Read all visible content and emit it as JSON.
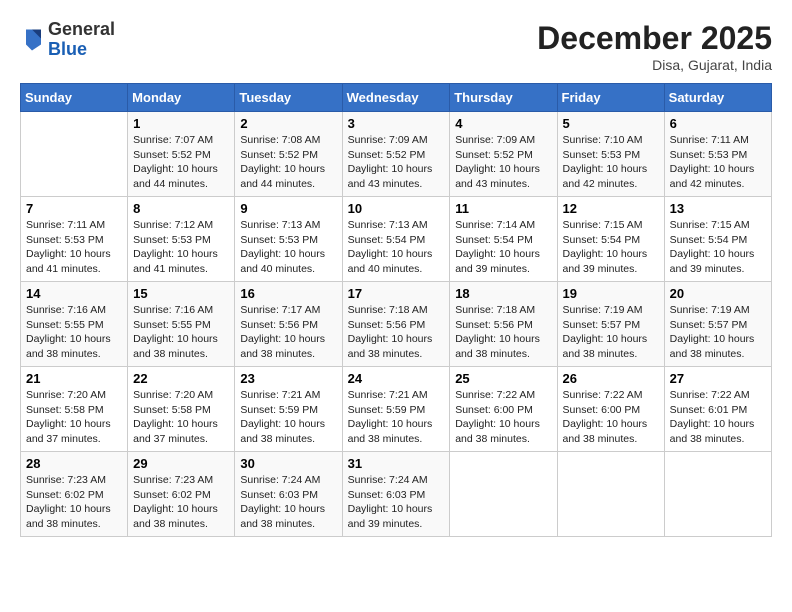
{
  "header": {
    "logo_general": "General",
    "logo_blue": "Blue",
    "month_title": "December 2025",
    "location": "Disa, Gujarat, India"
  },
  "weekdays": [
    "Sunday",
    "Monday",
    "Tuesday",
    "Wednesday",
    "Thursday",
    "Friday",
    "Saturday"
  ],
  "weeks": [
    [
      {
        "day": "",
        "info": ""
      },
      {
        "day": "1",
        "info": "Sunrise: 7:07 AM\nSunset: 5:52 PM\nDaylight: 10 hours\nand 44 minutes."
      },
      {
        "day": "2",
        "info": "Sunrise: 7:08 AM\nSunset: 5:52 PM\nDaylight: 10 hours\nand 44 minutes."
      },
      {
        "day": "3",
        "info": "Sunrise: 7:09 AM\nSunset: 5:52 PM\nDaylight: 10 hours\nand 43 minutes."
      },
      {
        "day": "4",
        "info": "Sunrise: 7:09 AM\nSunset: 5:52 PM\nDaylight: 10 hours\nand 43 minutes."
      },
      {
        "day": "5",
        "info": "Sunrise: 7:10 AM\nSunset: 5:53 PM\nDaylight: 10 hours\nand 42 minutes."
      },
      {
        "day": "6",
        "info": "Sunrise: 7:11 AM\nSunset: 5:53 PM\nDaylight: 10 hours\nand 42 minutes."
      }
    ],
    [
      {
        "day": "7",
        "info": "Sunrise: 7:11 AM\nSunset: 5:53 PM\nDaylight: 10 hours\nand 41 minutes."
      },
      {
        "day": "8",
        "info": "Sunrise: 7:12 AM\nSunset: 5:53 PM\nDaylight: 10 hours\nand 41 minutes."
      },
      {
        "day": "9",
        "info": "Sunrise: 7:13 AM\nSunset: 5:53 PM\nDaylight: 10 hours\nand 40 minutes."
      },
      {
        "day": "10",
        "info": "Sunrise: 7:13 AM\nSunset: 5:54 PM\nDaylight: 10 hours\nand 40 minutes."
      },
      {
        "day": "11",
        "info": "Sunrise: 7:14 AM\nSunset: 5:54 PM\nDaylight: 10 hours\nand 39 minutes."
      },
      {
        "day": "12",
        "info": "Sunrise: 7:15 AM\nSunset: 5:54 PM\nDaylight: 10 hours\nand 39 minutes."
      },
      {
        "day": "13",
        "info": "Sunrise: 7:15 AM\nSunset: 5:54 PM\nDaylight: 10 hours\nand 39 minutes."
      }
    ],
    [
      {
        "day": "14",
        "info": "Sunrise: 7:16 AM\nSunset: 5:55 PM\nDaylight: 10 hours\nand 38 minutes."
      },
      {
        "day": "15",
        "info": "Sunrise: 7:16 AM\nSunset: 5:55 PM\nDaylight: 10 hours\nand 38 minutes."
      },
      {
        "day": "16",
        "info": "Sunrise: 7:17 AM\nSunset: 5:56 PM\nDaylight: 10 hours\nand 38 minutes."
      },
      {
        "day": "17",
        "info": "Sunrise: 7:18 AM\nSunset: 5:56 PM\nDaylight: 10 hours\nand 38 minutes."
      },
      {
        "day": "18",
        "info": "Sunrise: 7:18 AM\nSunset: 5:56 PM\nDaylight: 10 hours\nand 38 minutes."
      },
      {
        "day": "19",
        "info": "Sunrise: 7:19 AM\nSunset: 5:57 PM\nDaylight: 10 hours\nand 38 minutes."
      },
      {
        "day": "20",
        "info": "Sunrise: 7:19 AM\nSunset: 5:57 PM\nDaylight: 10 hours\nand 38 minutes."
      }
    ],
    [
      {
        "day": "21",
        "info": "Sunrise: 7:20 AM\nSunset: 5:58 PM\nDaylight: 10 hours\nand 37 minutes."
      },
      {
        "day": "22",
        "info": "Sunrise: 7:20 AM\nSunset: 5:58 PM\nDaylight: 10 hours\nand 37 minutes."
      },
      {
        "day": "23",
        "info": "Sunrise: 7:21 AM\nSunset: 5:59 PM\nDaylight: 10 hours\nand 38 minutes."
      },
      {
        "day": "24",
        "info": "Sunrise: 7:21 AM\nSunset: 5:59 PM\nDaylight: 10 hours\nand 38 minutes."
      },
      {
        "day": "25",
        "info": "Sunrise: 7:22 AM\nSunset: 6:00 PM\nDaylight: 10 hours\nand 38 minutes."
      },
      {
        "day": "26",
        "info": "Sunrise: 7:22 AM\nSunset: 6:00 PM\nDaylight: 10 hours\nand 38 minutes."
      },
      {
        "day": "27",
        "info": "Sunrise: 7:22 AM\nSunset: 6:01 PM\nDaylight: 10 hours\nand 38 minutes."
      }
    ],
    [
      {
        "day": "28",
        "info": "Sunrise: 7:23 AM\nSunset: 6:02 PM\nDaylight: 10 hours\nand 38 minutes."
      },
      {
        "day": "29",
        "info": "Sunrise: 7:23 AM\nSunset: 6:02 PM\nDaylight: 10 hours\nand 38 minutes."
      },
      {
        "day": "30",
        "info": "Sunrise: 7:24 AM\nSunset: 6:03 PM\nDaylight: 10 hours\nand 38 minutes."
      },
      {
        "day": "31",
        "info": "Sunrise: 7:24 AM\nSunset: 6:03 PM\nDaylight: 10 hours\nand 39 minutes."
      },
      {
        "day": "",
        "info": ""
      },
      {
        "day": "",
        "info": ""
      },
      {
        "day": "",
        "info": ""
      }
    ]
  ]
}
